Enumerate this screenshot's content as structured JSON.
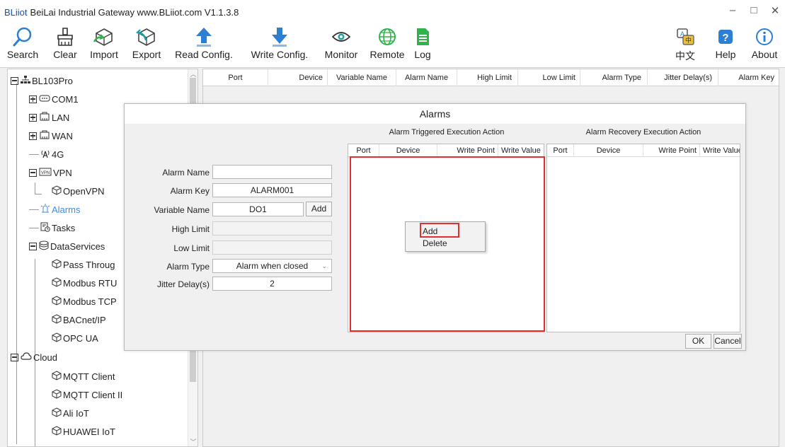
{
  "window": {
    "brand": "BLiiot",
    "title": "BeiLai Industrial Gateway www.BLiiot.com V1.1.3.8",
    "controls": [
      "–",
      "□",
      "✕"
    ]
  },
  "toolbar": {
    "search": "Search",
    "clear": "Clear",
    "import": "Import",
    "export": "Export",
    "read_config": "Read Config.",
    "write_config": "Write Config.",
    "monitor": "Monitor",
    "remote": "Remote",
    "log": "Log",
    "language": "中文",
    "help": "Help",
    "about": "About",
    "colors": {
      "blue": "#2d7fd3",
      "green": "#2fb34a",
      "teal": "#1fa0a0"
    }
  },
  "tree": {
    "root": "BL103Pro",
    "com1": "COM1",
    "lan": "LAN",
    "wan": "WAN",
    "g4": "4G",
    "vpn": "VPN",
    "openvpn": "OpenVPN",
    "alarms": "Alarms",
    "tasks": "Tasks",
    "dataservices": "DataServices",
    "pass_through": "Pass Throug",
    "modbus_rtu": "Modbus RTU",
    "modbus_tcp": "Modbus TCP",
    "bacnet": "BACnet/IP",
    "opcua": "OPC UA",
    "cloud": "Cloud",
    "mqtt_client": "MQTT Client",
    "mqtt_client_2": "MQTT Client II",
    "ali_iot": "Ali IoT",
    "huawei_iot": "HUAWEI IoT",
    "selected_color": "#3a8ee6"
  },
  "grid": {
    "columns": [
      "Port",
      "Device",
      "Variable Name",
      "Alarm Name",
      "High Limit",
      "Low Limit",
      "Alarm Type",
      "Jitter Delay(s)",
      "Alarm Key"
    ]
  },
  "dialog": {
    "title": "Alarms",
    "fields": {
      "alarm_name_label": "Alarm Name",
      "alarm_name_value": "",
      "alarm_key_label": "Alarm Key",
      "alarm_key_value": "ALARM001",
      "variable_name_label": "Variable Name",
      "variable_name_value": "DO1",
      "add_button": "Add",
      "high_limit_label": "High Limit",
      "high_limit_value": "",
      "low_limit_label": "Low Limit",
      "low_limit_value": "",
      "alarm_type_label": "Alarm Type",
      "alarm_type_value": "Alarm when closed",
      "jitter_delay_label": "Jitter Delay(s)",
      "jitter_delay_value": "2"
    },
    "triggered": {
      "title": "Alarm Triggered Execution Action",
      "columns": [
        "Port",
        "Device",
        "Write Point",
        "Write Value"
      ]
    },
    "recovery": {
      "title": "Alarm Recovery Execution Action",
      "columns": [
        "Port",
        "Device",
        "Write Point",
        "Write Value"
      ]
    },
    "ok_button": "OK",
    "cancel_button": "Cancel",
    "highlight_color": "#e02f2f"
  },
  "context_menu": {
    "add": "Add",
    "delete": "Delete"
  }
}
